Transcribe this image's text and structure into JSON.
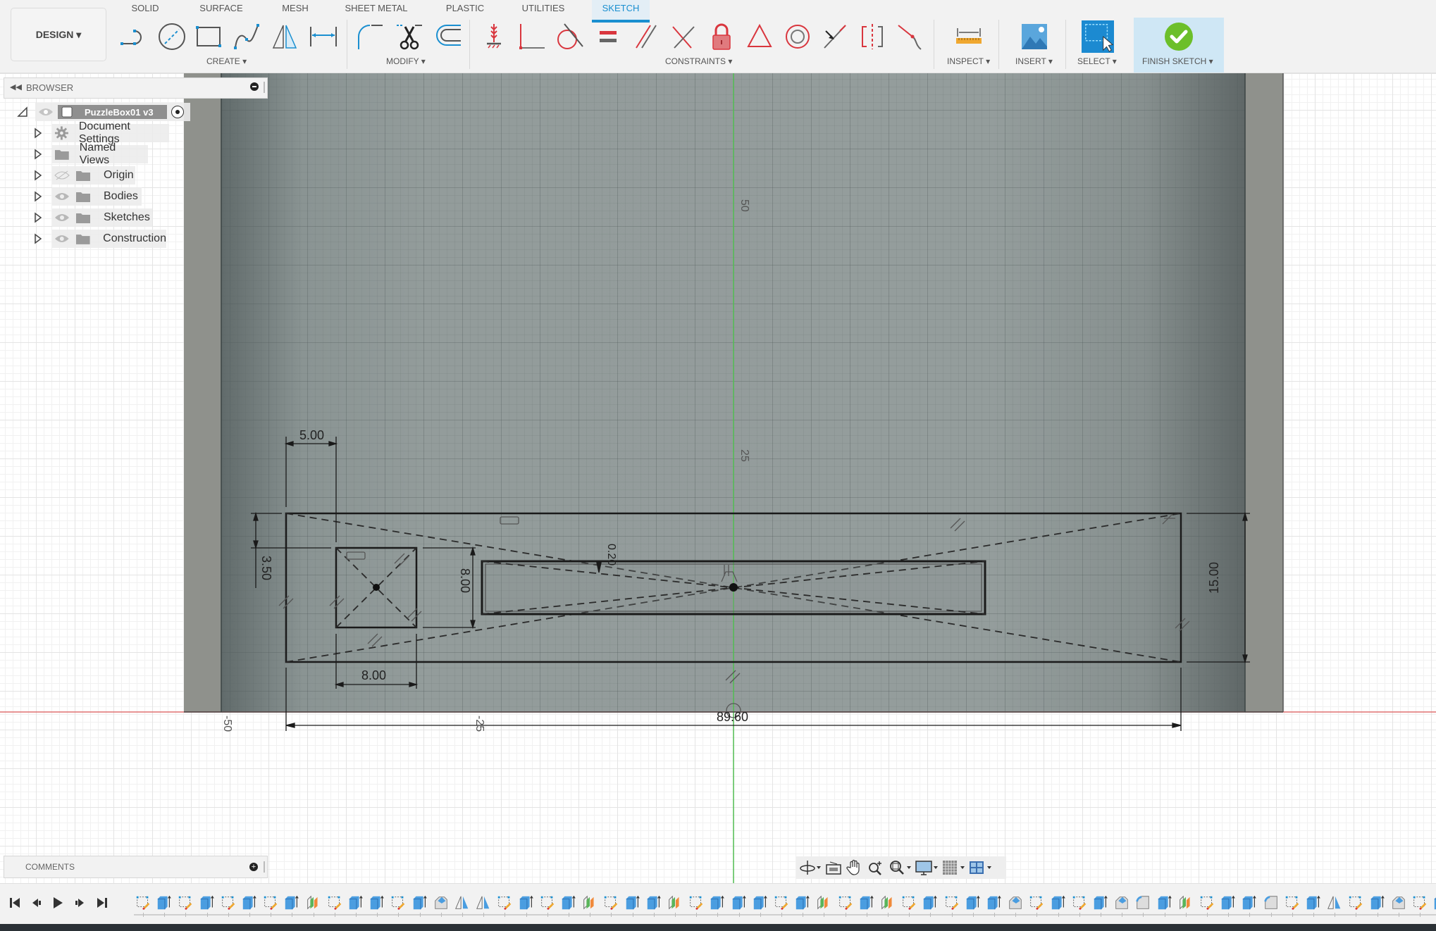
{
  "toolbar": {
    "workspace_button": "DESIGN ▾",
    "tabs": [
      {
        "label": "SOLID",
        "active": false
      },
      {
        "label": "SURFACE",
        "active": false
      },
      {
        "label": "MESH",
        "active": false
      },
      {
        "label": "SHEET METAL",
        "active": false
      },
      {
        "label": "PLASTIC",
        "active": false
      },
      {
        "label": "UTILITIES",
        "active": false
      },
      {
        "label": "SKETCH",
        "active": true
      }
    ],
    "groups": {
      "create": "CREATE ▾",
      "modify": "MODIFY ▾",
      "constraints": "CONSTRAINTS ▾",
      "inspect": "INSPECT ▾",
      "insert": "INSERT ▾",
      "select": "SELECT ▾",
      "finish": "FINISH SKETCH ▾"
    },
    "create_tools": [
      "line-icon",
      "circle-icon",
      "rectangle-icon",
      "spline-icon",
      "mirror-icon",
      "sketch-dimension-icon"
    ],
    "modify_tools": [
      "fillet-icon",
      "trim-icon",
      "offset-icon"
    ],
    "constraint_tools": [
      "fix-icon",
      "coincident-icon",
      "tangent-icon",
      "equal-icon",
      "parallel-icon",
      "perpendicular-icon",
      "lock-icon",
      "triangle-icon",
      "concentric-icon",
      "midpoint-icon",
      "symmetry-icon",
      "curvature-icon"
    ],
    "colors": {
      "accent": "#1a8fd0",
      "constraint": "#d9363e",
      "finish_check": "#6cbf2a",
      "finish_bg": "#cfe7f5"
    }
  },
  "browser": {
    "title": "BROWSER",
    "root": "PuzzleBox01 v3",
    "items": [
      {
        "label": "Document Settings",
        "icon": "gear-icon",
        "visible": null
      },
      {
        "label": "Named Views",
        "icon": "folder-icon",
        "visible": null
      },
      {
        "label": "Origin",
        "icon": "folder-icon",
        "visible": false
      },
      {
        "label": "Bodies",
        "icon": "folder-icon",
        "visible": true
      },
      {
        "label": "Sketches",
        "icon": "folder-icon",
        "visible": true
      },
      {
        "label": "Construction",
        "icon": "folder-icon",
        "visible": true
      }
    ]
  },
  "comments": {
    "title": "COMMENTS"
  },
  "sketch": {
    "axis_labels": {
      "y_50": "50",
      "y_25": "25",
      "x_neg50": "-50",
      "x_neg25": "-25"
    },
    "dimensions": {
      "d_left_offset": "5.00",
      "d_square_width": "8.00",
      "d_square_height": "8.00",
      "d_top_offset": "3.50",
      "d_slot_gap": "0.20",
      "d_overall_height": "15.00",
      "d_overall_width": "89.60"
    }
  },
  "navbar": {
    "tools": [
      "orbit-icon",
      "look-at-icon",
      "pan-icon",
      "zoom-icon",
      "zoom-window-icon",
      "display-settings-icon",
      "grid-icon",
      "viewports-icon"
    ]
  },
  "timeline": {
    "controls": [
      "first-icon",
      "previous-icon",
      "play-icon",
      "next-icon",
      "last-icon"
    ],
    "features": [
      "sketch",
      "extrude",
      "sketch",
      "extrude",
      "sketch",
      "extrude",
      "sketch",
      "extrude",
      "split",
      "sketch",
      "extrude",
      "extrude",
      "sketch",
      "extrude",
      "chamfer",
      "mirror",
      "mirror",
      "sketch",
      "extrude",
      "sketch",
      "extrude",
      "split",
      "sketch",
      "extrude",
      "extrude",
      "split",
      "sketch",
      "extrude",
      "extrude",
      "extrude",
      "sketch",
      "extrude",
      "split",
      "sketch",
      "extrude",
      "split",
      "sketch",
      "extrude",
      "sketch",
      "extrude",
      "extrude",
      "chamfer",
      "sketch",
      "extrude",
      "sketch",
      "extrude",
      "chamfer",
      "fillet",
      "extrude",
      "split",
      "sketch",
      "extrude",
      "extrude",
      "fillet",
      "sketch",
      "extrude",
      "mirror",
      "sketch",
      "extrude",
      "chamfer",
      "sketch",
      "extrude"
    ]
  }
}
